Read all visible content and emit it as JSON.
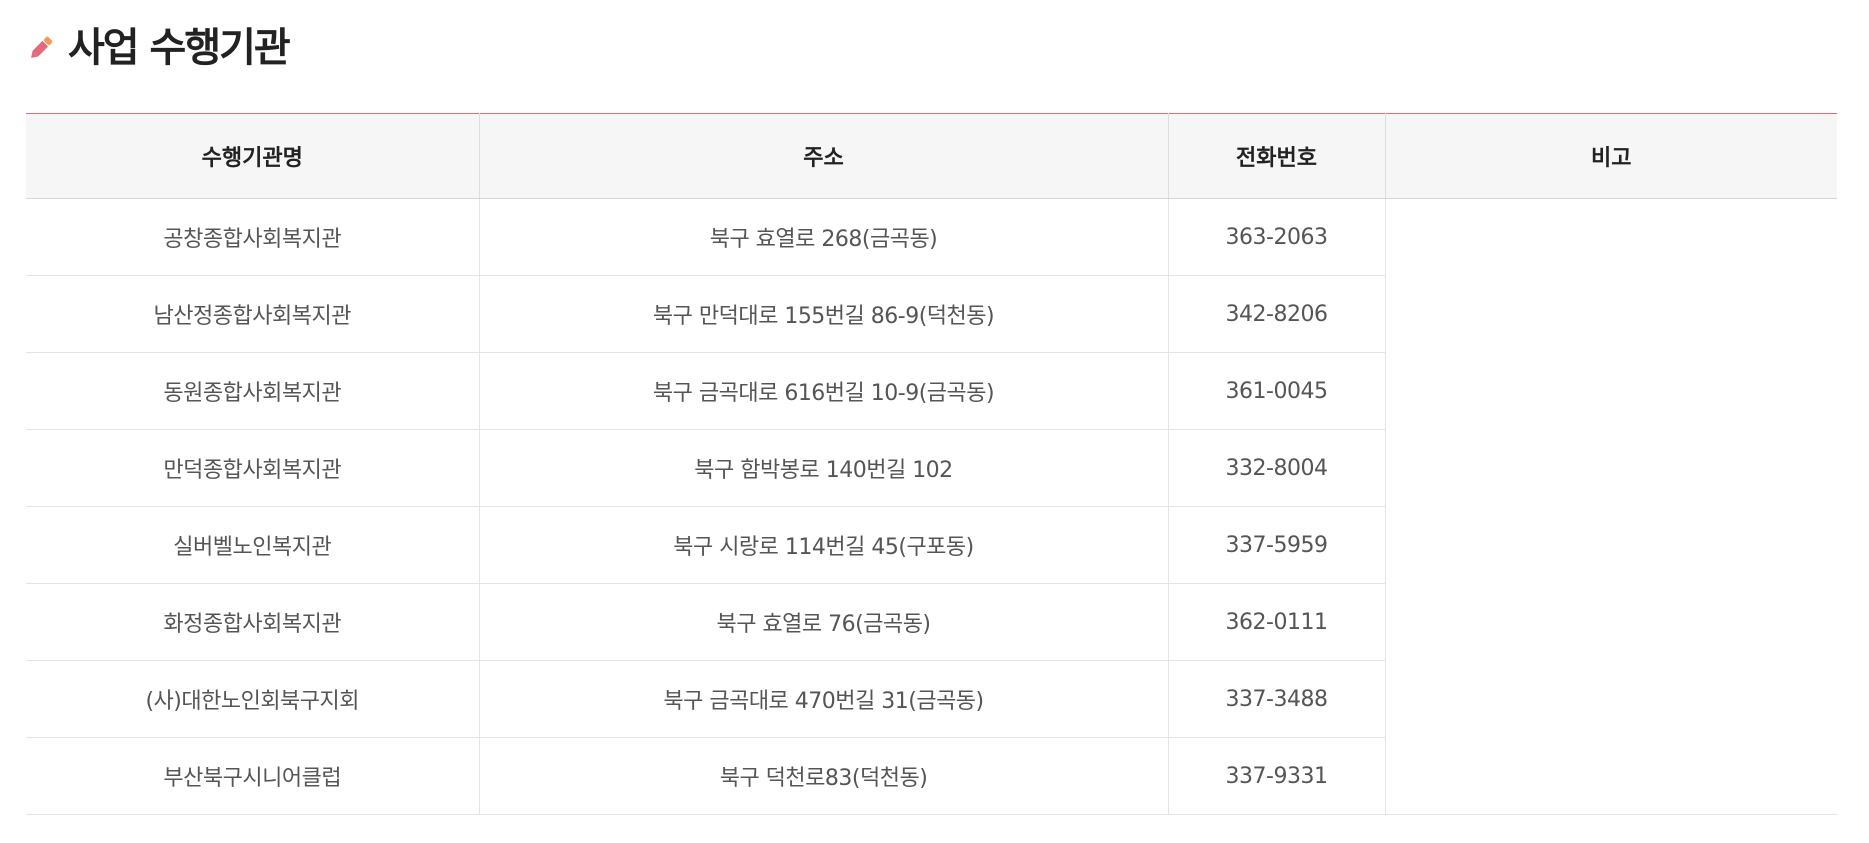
{
  "section": {
    "title": "사업 수행기관",
    "icon": "pencil-icon",
    "accent_color": "#e36a7c"
  },
  "table": {
    "headers": {
      "name": "수행기관명",
      "address": "주소",
      "phone": "전화번호",
      "note": "비고"
    },
    "rows": [
      {
        "name": "공창종합사회복지관",
        "address": "북구 효열로 268(금곡동)",
        "phone": "363-2063"
      },
      {
        "name": "남산정종합사회복지관",
        "address": "북구 만덕대로 155번길 86-9(덕천동)",
        "phone": "342-8206"
      },
      {
        "name": "동원종합사회복지관",
        "address": "북구 금곡대로 616번길 10-9(금곡동)",
        "phone": "361-0045"
      },
      {
        "name": "만덕종합사회복지관",
        "address": "북구 함박봉로 140번길 102",
        "phone": "332-8004"
      },
      {
        "name": "실버벨노인복지관",
        "address": "북구 시랑로 114번길 45(구포동)",
        "phone": "337-5959"
      },
      {
        "name": "화정종합사회복지관",
        "address": "북구 효열로 76(금곡동)",
        "phone": "362-0111"
      },
      {
        "name": "(사)대한노인회북구지회",
        "address": "북구 금곡대로 470번길 31(금곡동)",
        "phone": "337-3488"
      },
      {
        "name": "부산북구시니어클럽",
        "address": "북구 덕천로83(덕천동)",
        "phone": "337-9331"
      }
    ],
    "note": ""
  }
}
